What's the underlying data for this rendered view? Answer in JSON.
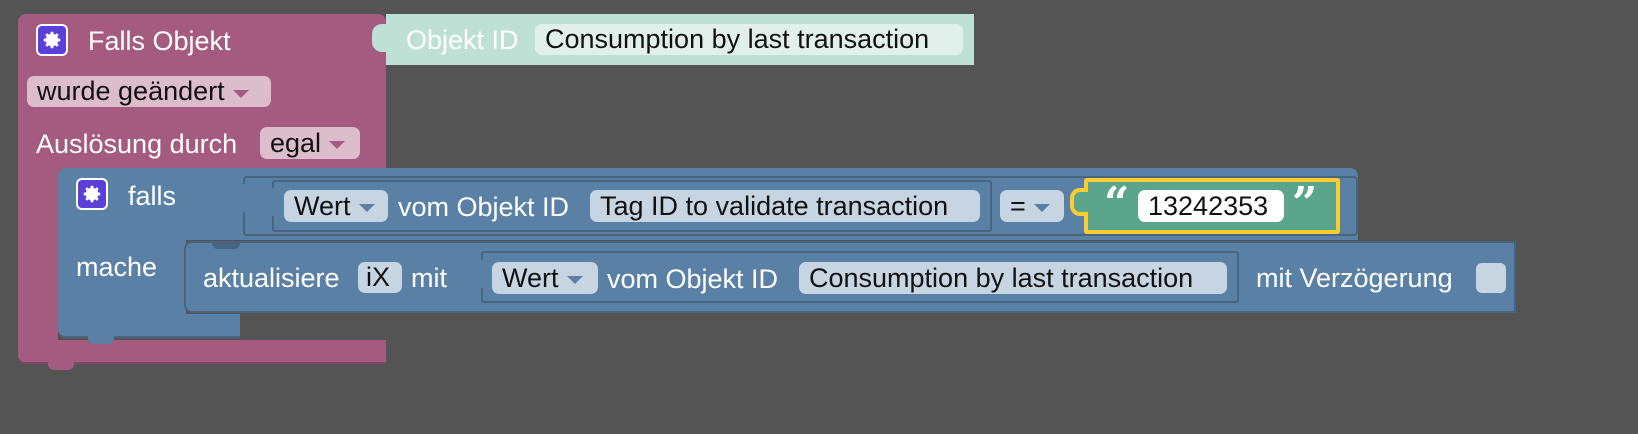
{
  "trigger_block": {
    "title": "Falls Objekt",
    "object_id_label": "Objekt ID",
    "object_id_value": "Consumption by last transaction",
    "change_dropdown": "wurde geändert",
    "trigger_label": "Auslösung durch",
    "trigger_dropdown": "egal"
  },
  "if_block": {
    "if_label": "falls",
    "do_label": "mache",
    "condition": {
      "value_dropdown": "Wert",
      "of_object_label": "vom Objekt ID",
      "object_id_value": "Tag ID to validate transaction",
      "operator": "=",
      "string_open_quote": "“",
      "string_value": "13242353",
      "string_close_quote": "”"
    }
  },
  "update_block": {
    "label": "aktualisiere",
    "variable": "iX",
    "with_label": "mit",
    "value_dropdown": "Wert",
    "of_object_label": "vom Objekt ID",
    "object_id_value": "Consumption by last transaction",
    "delay_label": "mit Verzögerung"
  },
  "colors": {
    "background": "#545454",
    "trigger_block": "#a55b80",
    "logic_block": "#5b80a5",
    "text_block": "#5ba58c",
    "object_id_block": "#bfe0d5",
    "selected_outline": "#fccd32"
  }
}
